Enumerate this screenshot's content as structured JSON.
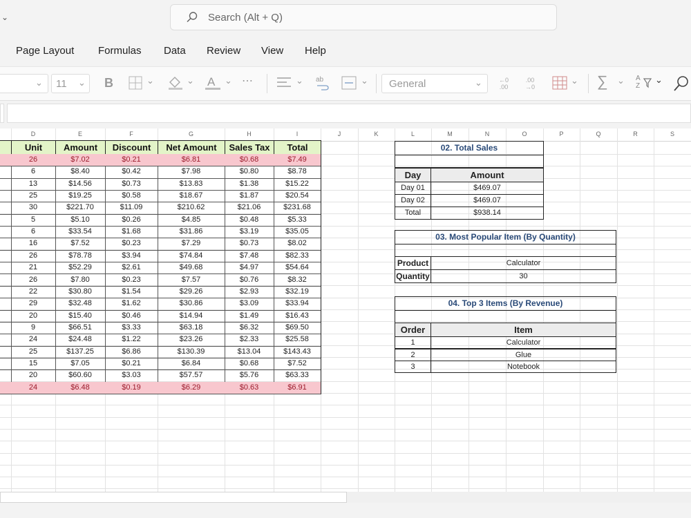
{
  "search": {
    "placeholder": "Search (Alt + Q)"
  },
  "menu": {
    "items": [
      "Page Layout",
      "Formulas",
      "Data",
      "Review",
      "View",
      "Help"
    ]
  },
  "ribbon": {
    "font_size": "11",
    "bold": "B",
    "number_format": "General",
    "increase_decimal": "←0\n.00",
    "decrease_decimal": ".00\n→0",
    "sum": "∑",
    "sort": "A\nZ"
  },
  "grid": {
    "columns": [
      "D",
      "E",
      "F",
      "G",
      "H",
      "I",
      "J",
      "K",
      "L",
      "M",
      "N",
      "O",
      "P",
      "Q",
      "R",
      "S"
    ],
    "headers": [
      "Unit",
      "Amount",
      "Discount",
      "Net Amount",
      "Sales Tax",
      "Total"
    ],
    "rows": [
      {
        "unit": "26",
        "amount": "$7.02",
        "discount": "$0.21",
        "net": "$6.81",
        "tax": "$0.68",
        "total": "$7.49",
        "highlight": true
      },
      {
        "unit": "6",
        "amount": "$8.40",
        "discount": "$0.42",
        "net": "$7.98",
        "tax": "$0.80",
        "total": "$8.78",
        "highlight": false
      },
      {
        "unit": "13",
        "amount": "$14.56",
        "discount": "$0.73",
        "net": "$13.83",
        "tax": "$1.38",
        "total": "$15.22",
        "highlight": false
      },
      {
        "unit": "25",
        "amount": "$19.25",
        "discount": "$0.58",
        "net": "$18.67",
        "tax": "$1.87",
        "total": "$20.54",
        "highlight": false
      },
      {
        "unit": "30",
        "amount": "$221.70",
        "discount": "$11.09",
        "net": "$210.62",
        "tax": "$21.06",
        "total": "$231.68",
        "highlight": false
      },
      {
        "unit": "5",
        "amount": "$5.10",
        "discount": "$0.26",
        "net": "$4.85",
        "tax": "$0.48",
        "total": "$5.33",
        "highlight": false
      },
      {
        "unit": "6",
        "amount": "$33.54",
        "discount": "$1.68",
        "net": "$31.86",
        "tax": "$3.19",
        "total": "$35.05",
        "highlight": false
      },
      {
        "unit": "16",
        "amount": "$7.52",
        "discount": "$0.23",
        "net": "$7.29",
        "tax": "$0.73",
        "total": "$8.02",
        "highlight": false
      },
      {
        "unit": "26",
        "amount": "$78.78",
        "discount": "$3.94",
        "net": "$74.84",
        "tax": "$7.48",
        "total": "$82.33",
        "highlight": false
      },
      {
        "unit": "21",
        "amount": "$52.29",
        "discount": "$2.61",
        "net": "$49.68",
        "tax": "$4.97",
        "total": "$54.64",
        "highlight": false
      },
      {
        "unit": "26",
        "amount": "$7.80",
        "discount": "$0.23",
        "net": "$7.57",
        "tax": "$0.76",
        "total": "$8.32",
        "highlight": false
      },
      {
        "unit": "22",
        "amount": "$30.80",
        "discount": "$1.54",
        "net": "$29.26",
        "tax": "$2.93",
        "total": "$32.19",
        "highlight": false
      },
      {
        "unit": "29",
        "amount": "$32.48",
        "discount": "$1.62",
        "net": "$30.86",
        "tax": "$3.09",
        "total": "$33.94",
        "highlight": false
      },
      {
        "unit": "20",
        "amount": "$15.40",
        "discount": "$0.46",
        "net": "$14.94",
        "tax": "$1.49",
        "total": "$16.43",
        "highlight": false
      },
      {
        "unit": "9",
        "amount": "$66.51",
        "discount": "$3.33",
        "net": "$63.18",
        "tax": "$6.32",
        "total": "$69.50",
        "highlight": false
      },
      {
        "unit": "24",
        "amount": "$24.48",
        "discount": "$1.22",
        "net": "$23.26",
        "tax": "$2.33",
        "total": "$25.58",
        "highlight": false
      },
      {
        "unit": "25",
        "amount": "$137.25",
        "discount": "$6.86",
        "net": "$130.39",
        "tax": "$13.04",
        "total": "$143.43",
        "highlight": false
      },
      {
        "unit": "15",
        "amount": "$7.05",
        "discount": "$0.21",
        "net": "$6.84",
        "tax": "$0.68",
        "total": "$7.52",
        "highlight": false
      },
      {
        "unit": "20",
        "amount": "$60.60",
        "discount": "$3.03",
        "net": "$57.57",
        "tax": "$5.76",
        "total": "$63.33",
        "highlight": false
      },
      {
        "unit": "24",
        "amount": "$6.48",
        "discount": "$0.19",
        "net": "$6.29",
        "tax": "$0.63",
        "total": "$6.91",
        "highlight": true
      }
    ]
  },
  "total_sales": {
    "title": "02. Total Sales",
    "header_day": "Day",
    "header_amount": "Amount",
    "rows": [
      {
        "day": "Day 01",
        "amount": "$469.07"
      },
      {
        "day": "Day 02",
        "amount": "$469.07"
      },
      {
        "day": "Total",
        "amount": "$938.14"
      }
    ]
  },
  "popular_item": {
    "title": "03. Most Popular Item (By Quantity)",
    "product_label": "Product",
    "product_value": "Calculator",
    "quantity_label": "Quantity",
    "quantity_value": "30"
  },
  "top_items": {
    "title": "04. Top 3 Items (By Revenue)",
    "header_order": "Order",
    "header_item": "Item",
    "rows": [
      {
        "order": "1",
        "item": "Calculator"
      },
      {
        "order": "2",
        "item": "Glue"
      },
      {
        "order": "3",
        "item": "Notebook"
      }
    ]
  },
  "colors": {
    "header_fill": "#e3f4c8",
    "highlight_fill": "#f8c7ce",
    "highlight_text": "#9c1c2c",
    "report_title": "#2a4a78"
  }
}
